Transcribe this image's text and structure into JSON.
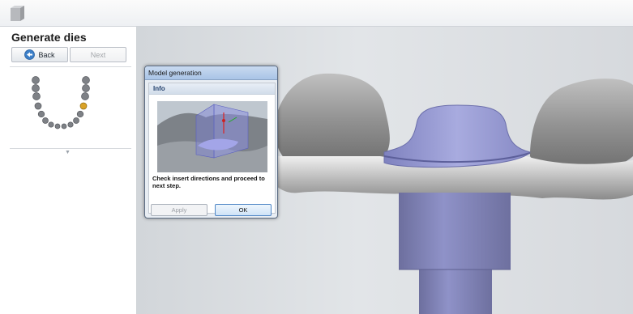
{
  "panel": {
    "title": "Generate dies",
    "back_label": "Back",
    "next_label": "Next"
  },
  "dialog": {
    "title": "Model generation",
    "section_label": "Info",
    "message": "Check insert directions and proceed to next step.",
    "apply_label": "Apply",
    "ok_label": "OK"
  },
  "icons": {
    "app": "model-icon",
    "back": "back-arrow-icon",
    "collapse": "chevron-down-icon"
  },
  "tooth_chart": {
    "teeth_count": 16,
    "selected_tooth_color": "#d9a227"
  },
  "colors": {
    "die_color": "#9d9fd6",
    "model_gray": "#8a8a8a",
    "accent_blue": "#4f86c6"
  }
}
